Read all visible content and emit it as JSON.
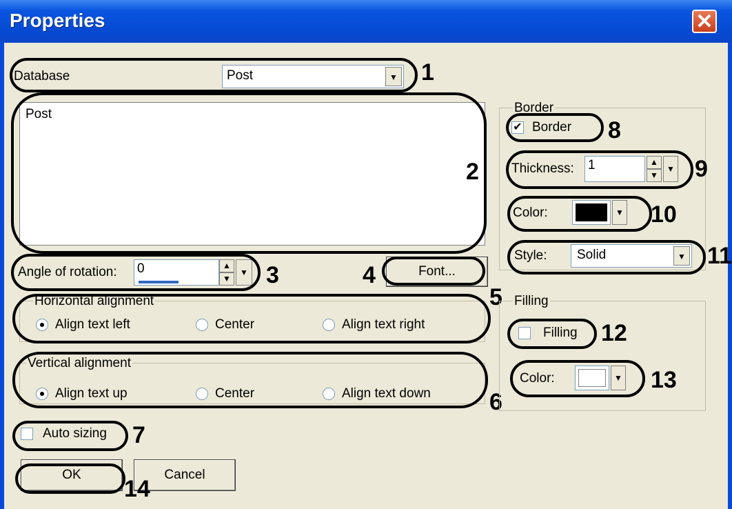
{
  "window": {
    "title": "Properties",
    "close_glyph": "✕"
  },
  "database": {
    "label": "Database",
    "value": "Post"
  },
  "text_area": {
    "value": "Post"
  },
  "rotation": {
    "label": "Angle of rotation:",
    "value": "0"
  },
  "font_button": "Font...",
  "horizontal": {
    "title": "Horizontal alignment",
    "left": "Align text left",
    "center": "Center",
    "right": "Align text right",
    "selected": "left"
  },
  "vertical": {
    "title": "Vertical alignment",
    "up": "Align text up",
    "center": "Center",
    "down": "Align text down",
    "selected": "up"
  },
  "auto_sizing": {
    "label": "Auto sizing",
    "checked": false
  },
  "border": {
    "group_title": "Border",
    "checkbox_label": "Border",
    "checked": true,
    "thickness_label": "Thickness:",
    "thickness_value": "1",
    "color_label": "Color:",
    "color": "#000000",
    "style_label": "Style:",
    "style_value": "Solid"
  },
  "filling": {
    "group_title": "Filling",
    "checkbox_label": "Filling",
    "checked": false,
    "color_label": "Color:",
    "color": "#ffffff"
  },
  "buttons": {
    "ok": "OK",
    "cancel": "Cancel"
  },
  "callouts": [
    "1",
    "2",
    "3",
    "4",
    "5",
    "6",
    "7",
    "8",
    "9",
    "10",
    "11",
    "12",
    "13",
    "14"
  ],
  "icons": {
    "dropdown": "chevron-down-icon",
    "spin_up": "spin-up-icon",
    "spin_down": "spin-down-icon"
  },
  "colors": {
    "titlebar": "#0a55e0",
    "client": "#ece9d8",
    "ring": "#000000"
  }
}
